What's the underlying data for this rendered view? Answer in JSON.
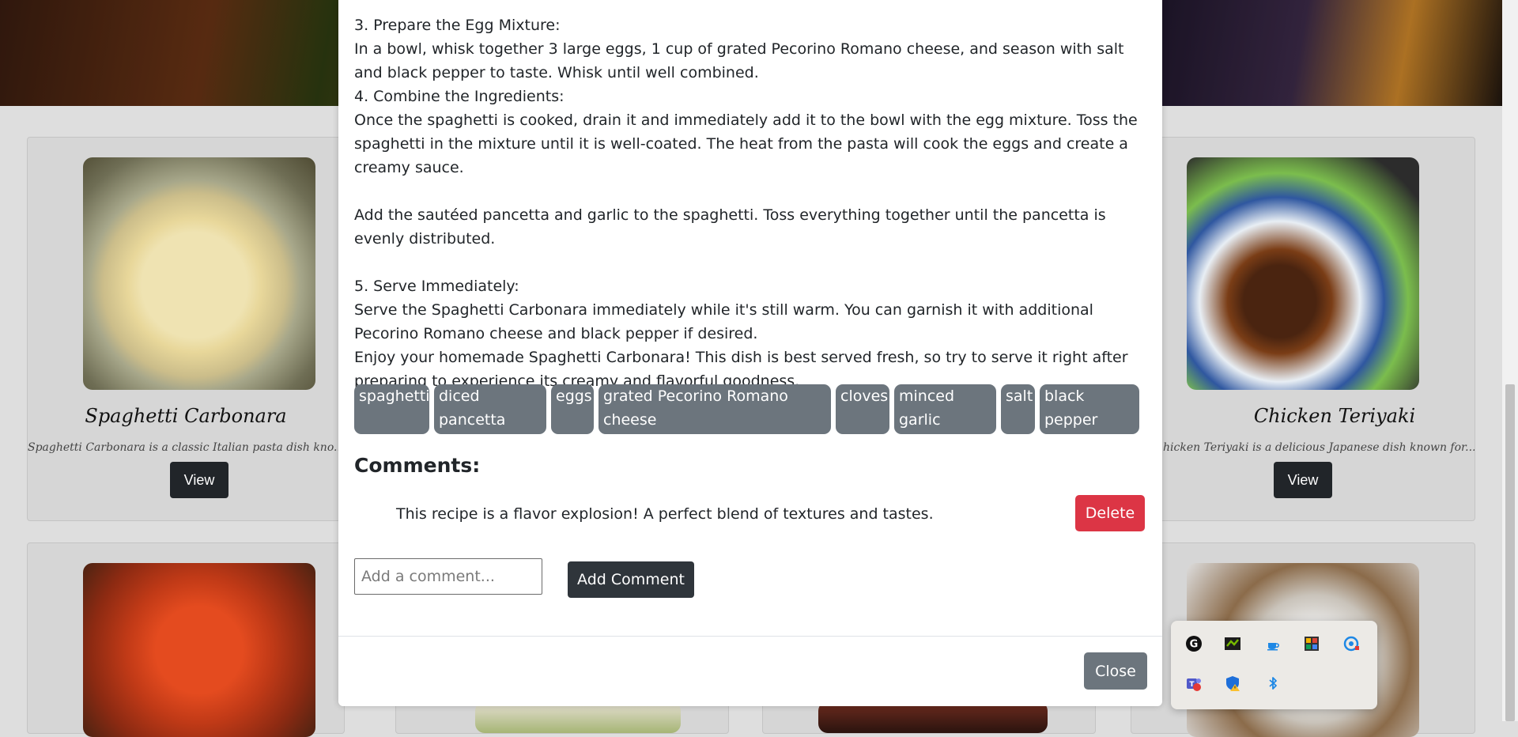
{
  "cards": [
    {
      "title": "Spaghetti Carbonara",
      "desc": "Spaghetti Carbonara is a classic Italian pasta dish kno...",
      "button": "View"
    },
    {
      "title": "Chicken Teriyaki",
      "desc": "hicken Teriyaki is a delicious Japanese dish known for...",
      "button": "View"
    }
  ],
  "modal": {
    "instructions": [
      "3. Prepare the Egg Mixture:",
      "In a bowl, whisk together 3 large eggs, 1 cup of grated Pecorino Romano cheese, and season with salt and black pepper to taste. Whisk until well combined.",
      "4. Combine the Ingredients:",
      "Once the spaghetti is cooked, drain it and immediately add it to the bowl with the egg mixture. Toss the spaghetti in the mixture until it is well-coated. The heat from the pasta will cook the eggs and create a creamy sauce.",
      "",
      "Add the sautéed pancetta and garlic to the spaghetti. Toss everything together until the pancetta is evenly distributed.",
      "",
      "5. Serve Immediately:",
      "Serve the Spaghetti Carbonara immediately while it's still warm. You can garnish it with additional Pecorino Romano cheese and black pepper if desired.",
      "Enjoy your homemade Spaghetti Carbonara! This dish is best served fresh, so try to serve it right after preparing to experience its creamy and flavorful goodness."
    ],
    "ingredients": [
      "spaghetti",
      "diced pancetta",
      "eggs",
      "grated Pecorino Romano cheese",
      "cloves",
      "minced garlic",
      "salt",
      "black pepper"
    ],
    "comments_title": "Comments:",
    "comments": [
      {
        "text": "This recipe is a flavor explosion! A perfect blend of textures and tastes.",
        "delete_label": "Delete"
      }
    ],
    "comment_placeholder": "Add a comment...",
    "add_comment_label": "Add Comment",
    "close_label": "Close"
  },
  "tray": {
    "icons": [
      "g-hub-icon",
      "nvidia-icon",
      "java-icon",
      "color-app-icon",
      "display-settings-icon",
      "teams-icon",
      "security-warning-icon",
      "bluetooth-icon"
    ]
  },
  "colors": {
    "danger": "#dc3545",
    "dark": "#212529",
    "secondary": "#6c757d"
  }
}
